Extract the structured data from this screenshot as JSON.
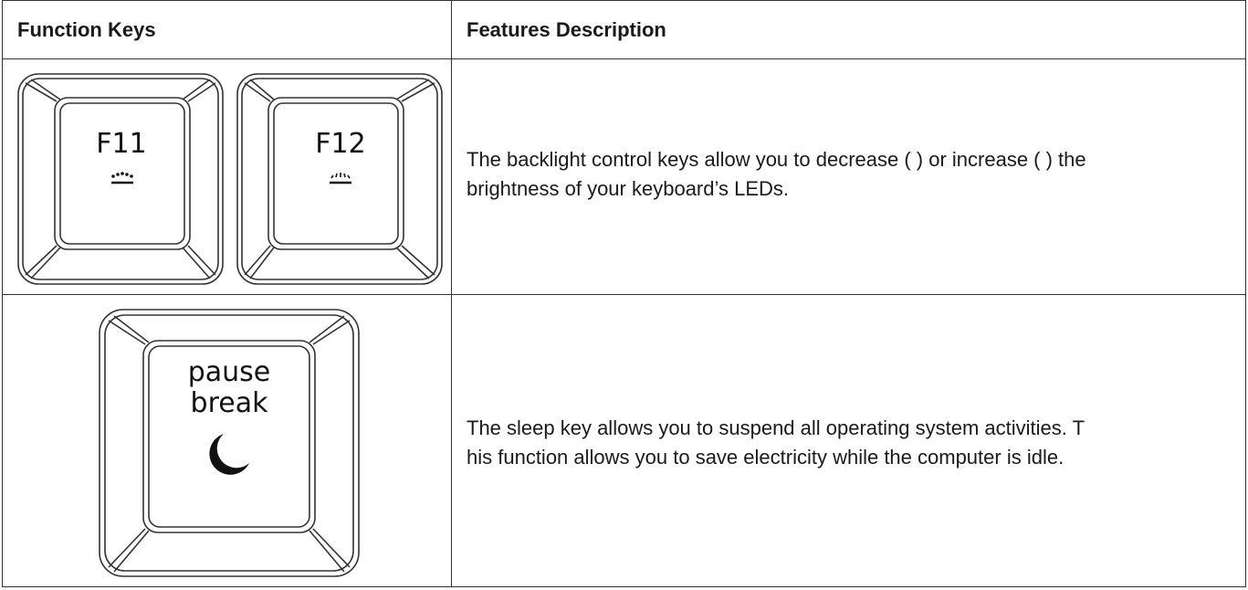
{
  "table": {
    "headers": {
      "col1": "Function Keys",
      "col2": "Features Description"
    },
    "rows": [
      {
        "keys": [
          {
            "label": "F11",
            "icon": "brightness-down-icon"
          },
          {
            "label": "F12",
            "icon": "brightness-up-icon"
          }
        ],
        "description_line1": "The backlight control keys allow you to decrease ( ) or increase ( ) the",
        "description_line2": "brightness of your keyboard’s LEDs."
      },
      {
        "keys": [
          {
            "label_line1": "pause",
            "label_line2": "break",
            "icon": "moon-icon"
          }
        ],
        "description_line1": "The sleep key allows you to suspend all operating system activities. T",
        "description_line2": "his function allows you to save electricity while the computer is idle."
      }
    ]
  }
}
